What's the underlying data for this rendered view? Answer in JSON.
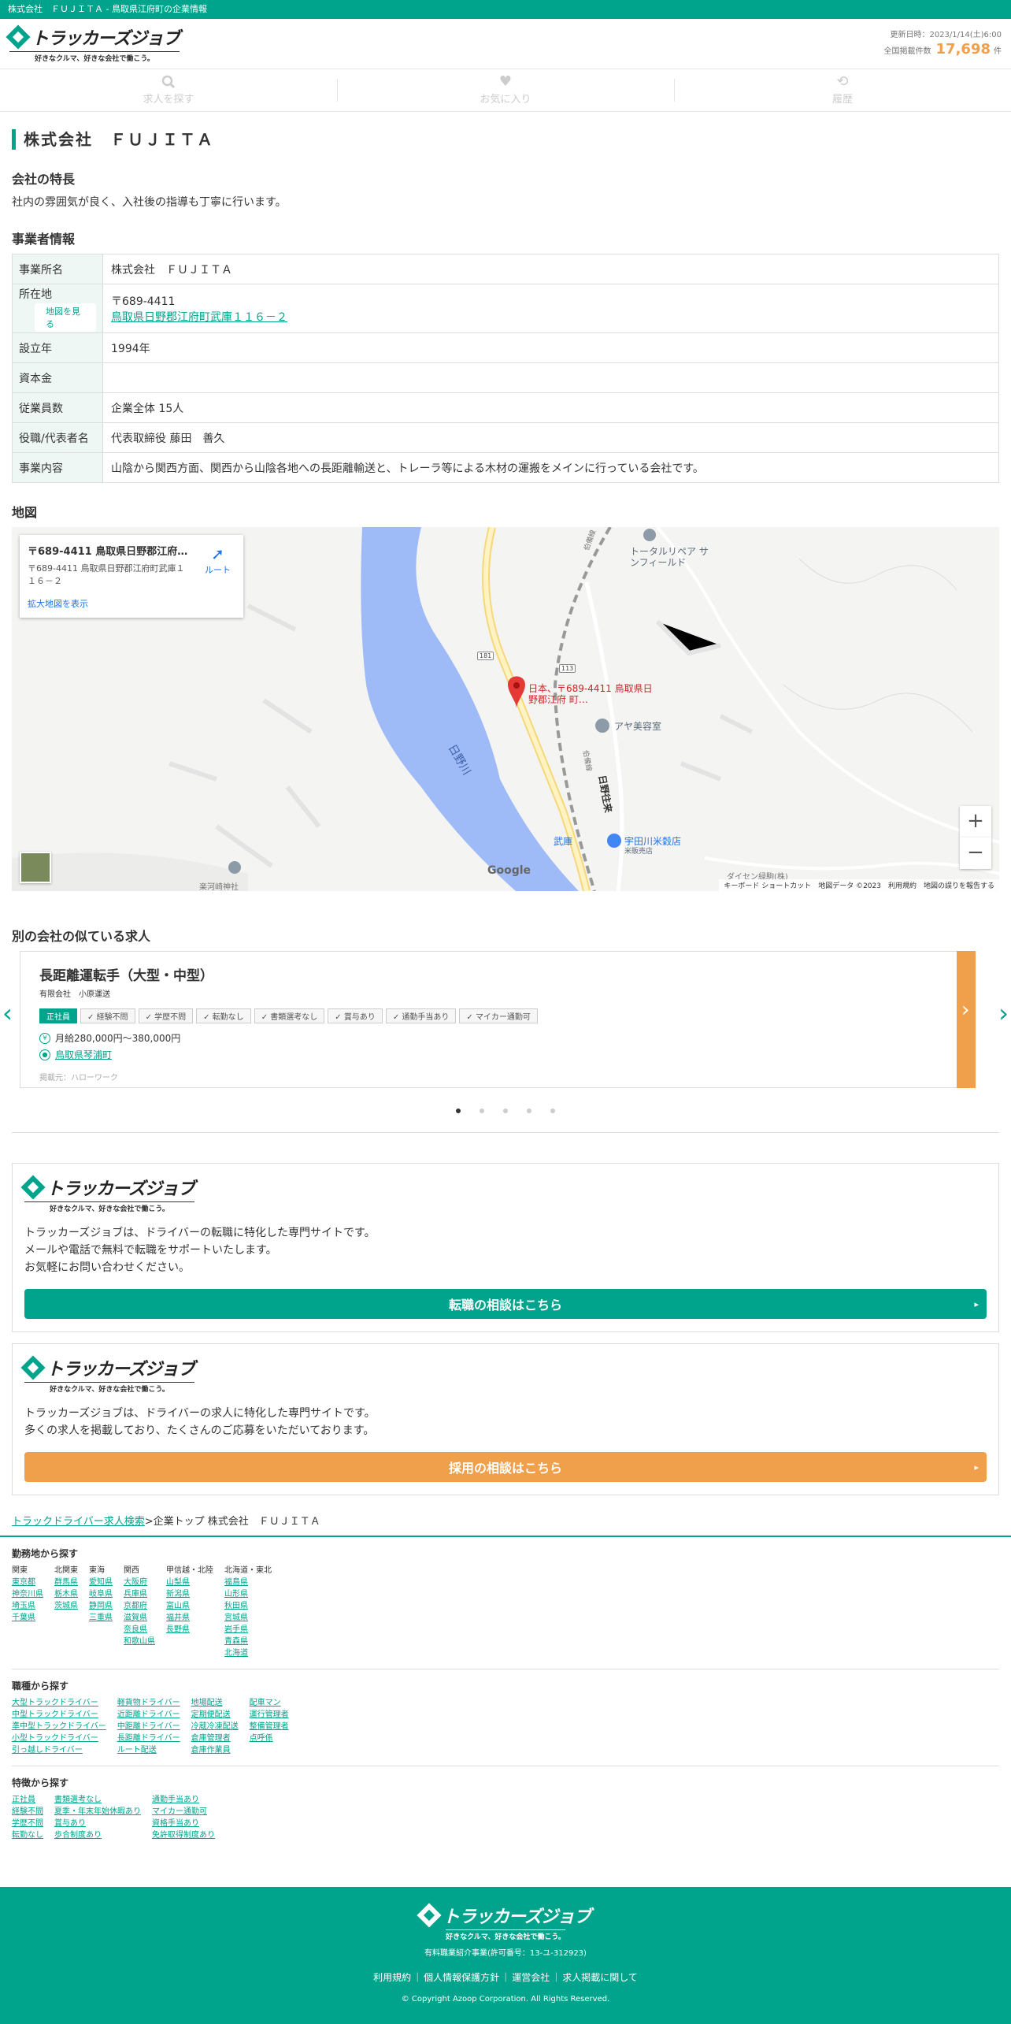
{
  "topbar": "株式会社　ＦＵＪＩＴＡ - 鳥取県江府町の企業情報",
  "logo": {
    "name": "トラッカーズジョブ",
    "tagline": "好きなクルマ、好きな会社で働こう。"
  },
  "header": {
    "updated": "更新日時：2023/1/14(土)6:00",
    "count_label": "全国掲載件数",
    "count": "17,698",
    "count_unit": "件"
  },
  "nav": {
    "search": "求人を探す",
    "favorites": "お気に入り",
    "history": "履歴"
  },
  "page_title": "株式会社　ＦＵＪＩＴＡ",
  "features": {
    "title": "会社の特長",
    "text": "社内の雰囲気が良く、入社後の指導も丁寧に行います。"
  },
  "business": {
    "title": "事業者情報",
    "name_label": "事業所名",
    "name": "株式会社　ＦＵＪＩＴＡ",
    "addr_label": "所在地",
    "map_button": "地図を見る",
    "zip": "〒689-4411",
    "address": "鳥取県日野郡江府町武庫１１６－２",
    "founded_label": "設立年",
    "founded": "1994年",
    "capital_label": "資本金",
    "capital": "",
    "employees_label": "従業員数",
    "employees": "企業全体 15人",
    "rep_label": "役職/代表者名",
    "rep": "代表取締役 藤田　善久",
    "desc_label": "事業内容",
    "desc": "山陰から関西方面、関西から山陰各地への長距離輸送と、トレーラ等による木材の運搬をメインに行っている会社です。"
  },
  "map": {
    "title": "地図",
    "card_title": "〒689-4411 鳥取県日野郡江府町武庫…",
    "card_addr": "〒689-4411 鳥取県日野郡江府町武庫１１６－２",
    "route": "ルート",
    "enlarge": "拡大地図を表示",
    "pin_label": "日本、〒689-4411 鳥取県日野郡江府 町…",
    "places": {
      "place1": "トータルリペア サンフィールド",
      "place2": "アヤ美容室",
      "place3": "宇田川米穀店",
      "place3_sub": "米販売店",
      "station": "武庫",
      "river": "日野川",
      "road": "伯備線",
      "road2": "日野往来",
      "bottom": "ダイセン緑駒(株)",
      "shrine": "楽河崎神社",
      "route_num": "181",
      "route_num2": "113"
    },
    "google": "Google",
    "attribution": "キーボード ショートカット　地図データ ©2023　利用規約　地図の誤りを報告する"
  },
  "similar": {
    "title": "別の会社の似ている求人",
    "job_title": "長距離運転手（大型・中型）",
    "company": "有限会社　小原運送",
    "tags": [
      "正社員",
      "経験不問",
      "学歴不問",
      "転勤なし",
      "書類選考なし",
      "賞与あり",
      "通勤手当あり",
      "マイカー通勤可"
    ],
    "salary": "月給280,000円〜380,000円",
    "location": "鳥取県琴浦町",
    "source": "掲載元：ハローワーク"
  },
  "promo1": {
    "text1": "トラッカーズジョブは、ドライバーの転職に特化した専門サイトです。",
    "text2": "メールや電話で無料で転職をサポートいたします。",
    "text3": "お気軽にお問い合わせください。",
    "button": "転職の相談はこちら"
  },
  "promo2": {
    "text1": "トラッカーズジョブは、ドライバーの求人に特化した専門サイトです。",
    "text2": "多くの求人を掲載しており、たくさんのご応募をいただいております。",
    "button": "採用の相談はこちら"
  },
  "breadcrumb": {
    "link": "トラックドライバー求人検索",
    "sep": ">",
    "current": "企業トップ 株式会社　ＦＵＪＩＴＡ"
  },
  "area_search": {
    "title": "勤務地から探す",
    "columns": [
      {
        "head": "関東",
        "items": [
          "東京都",
          "神奈川県",
          "埼玉県",
          "千葉県"
        ]
      },
      {
        "head": "北関東",
        "items": [
          "群馬県",
          "栃木県",
          "茨城県"
        ]
      },
      {
        "head": "東海",
        "items": [
          "愛知県",
          "岐阜県",
          "静岡県",
          "三重県"
        ]
      },
      {
        "head": "関西",
        "items": [
          "大阪府",
          "兵庫県",
          "京都府",
          "滋賀県",
          "奈良県",
          "和歌山県"
        ]
      },
      {
        "head": "甲信越・北陸",
        "items": [
          "山梨県",
          "新潟県",
          "富山県",
          "福井県",
          "長野県"
        ]
      },
      {
        "head": "北海道・東北",
        "items": [
          "福島県",
          "山形県",
          "秋田県",
          "宮城県",
          "岩手県",
          "青森県",
          "北海道"
        ]
      }
    ]
  },
  "job_search": {
    "title": "職種から探す",
    "columns": [
      [
        "大型トラックドライバー",
        "中型トラックドライバー",
        "準中型トラックドライバー",
        "小型トラックドライバー",
        "引っ越しドライバー"
      ],
      [
        "軽貨物ドライバー",
        "近距離ドライバー",
        "中距離ドライバー",
        "長距離ドライバー",
        "ルート配送"
      ],
      [
        "地場配送",
        "定期便配送",
        "冷蔵冷凍配送",
        "倉庫管理者",
        "倉庫作業員"
      ],
      [
        "配車マン",
        "運行管理者",
        "整備管理者",
        "点呼係"
      ]
    ]
  },
  "feature_search": {
    "title": "特徴から探す",
    "columns": [
      [
        "正社員",
        "経験不問",
        "学歴不問",
        "転勤なし"
      ],
      [
        "書類選考なし",
        "夏季・年末年始休暇あり",
        "賞与あり",
        "歩合制度あり"
      ],
      [
        "通勤手当あり",
        "マイカー通勤可",
        "資格手当あり",
        "免許取得制度あり"
      ]
    ]
  },
  "footer": {
    "license": "有料職業紹介事業(許可番号：13-ユ-312923)",
    "links": [
      "利用規約",
      "個人情報保護方針",
      "運営会社",
      "求人掲載に関して"
    ],
    "copyright": "© Copyright Azoop Corporation. All Rights Reserved."
  },
  "colors": {
    "brand": "#00a48c",
    "accent": "#f0a04b",
    "river": "#9ebbf7"
  }
}
